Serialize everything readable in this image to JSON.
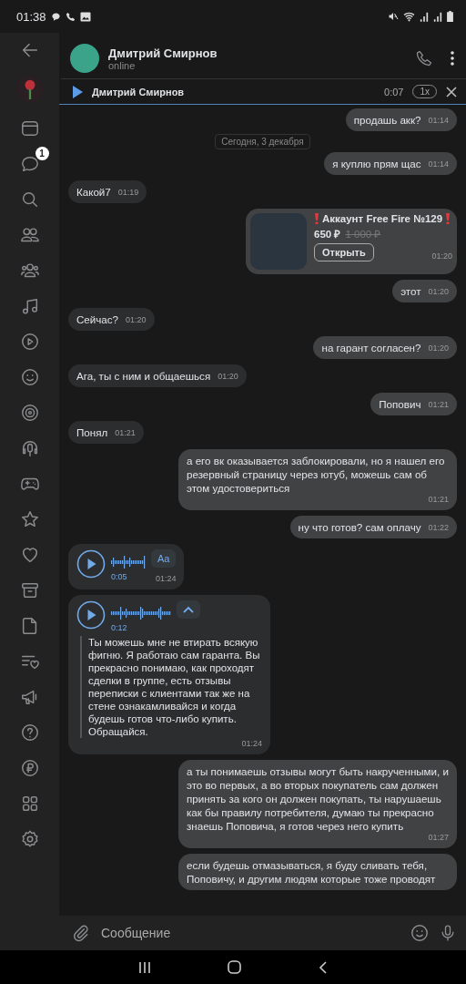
{
  "status_bar": {
    "time": "01:38"
  },
  "sidebar": {
    "items": [
      {
        "kind": "back"
      },
      {
        "kind": "community"
      },
      {
        "kind": "window"
      },
      {
        "kind": "chat",
        "badge": "1"
      },
      {
        "kind": "search"
      },
      {
        "kind": "people"
      },
      {
        "kind": "group"
      },
      {
        "kind": "music"
      },
      {
        "kind": "video"
      },
      {
        "kind": "smiley"
      },
      {
        "kind": "target"
      },
      {
        "kind": "podcast"
      },
      {
        "kind": "gamepad"
      },
      {
        "kind": "star"
      },
      {
        "kind": "heart"
      },
      {
        "kind": "archive"
      },
      {
        "kind": "document"
      },
      {
        "kind": "wishlist"
      },
      {
        "kind": "megaphone"
      },
      {
        "kind": "help"
      },
      {
        "kind": "ruble"
      },
      {
        "kind": "apps"
      },
      {
        "kind": "settings"
      }
    ]
  },
  "header": {
    "name": "Дмитрий Смирнов",
    "status": "online"
  },
  "player": {
    "title": "Дмитрий Смирнов",
    "time": "0:07",
    "speed": "1x"
  },
  "messages": [
    {
      "kind": "text",
      "outgoing": true,
      "text": "продашь акк?",
      "time": "01:14"
    },
    {
      "kind": "date",
      "text": "Сегодня, 3 декабря"
    },
    {
      "kind": "text",
      "outgoing": true,
      "text": "я куплю прям щас",
      "time": "01:14"
    },
    {
      "kind": "text",
      "outgoing": false,
      "text": "Какой7",
      "time": "01:19"
    },
    {
      "kind": "product",
      "outgoing": true,
      "title": "Аккаунт Free Fire №129",
      "price": "650 ₽",
      "old_price": "1 000 ₽",
      "button": "Открыть",
      "time": "01:20"
    },
    {
      "kind": "text",
      "outgoing": true,
      "text": "этот",
      "time": "01:20"
    },
    {
      "kind": "text",
      "outgoing": false,
      "text": "Сейчас?",
      "time": "01:20"
    },
    {
      "kind": "text",
      "outgoing": true,
      "text": "на гарант согласен?",
      "time": "01:20"
    },
    {
      "kind": "text",
      "outgoing": false,
      "text": "Ага, ты с ним и общаешься",
      "time": "01:20"
    },
    {
      "kind": "text",
      "outgoing": true,
      "text": "Попович",
      "time": "01:21"
    },
    {
      "kind": "text",
      "outgoing": false,
      "text": "Понял",
      "time": "01:21"
    },
    {
      "kind": "text",
      "outgoing": true,
      "text": "а его вк оказывается заблокировали, но я нашел его резервный страницу через ютуб, можешь сам об этом удостовериться",
      "time": "01:21"
    },
    {
      "kind": "text",
      "outgoing": true,
      "text": "ну что готов? сам оплачу",
      "time": "01:22"
    },
    {
      "kind": "voice",
      "outgoing": false,
      "duration": "0:05",
      "time": "01:24",
      "expanded": false,
      "button": "Aa"
    },
    {
      "kind": "voice",
      "outgoing": false,
      "duration": "0:12",
      "time": "01:24",
      "expanded": true,
      "transcript": "Ты можешь мне не втирать всякую фигню. Я работаю сам гаранта. Вы прекрасно понимаю, как проходят сделки в группе, есть отзывы переписки с клиентами так же на стене ознакамливайся и когда будешь готов что-либо купить. Обращайся."
    },
    {
      "kind": "text",
      "outgoing": true,
      "text": "а ты понимаешь отзывы могут быть накрученными, и это во первых, а во вторых покупатель сам должен принять за кого он должен покупать, ты нарушаешь как бы правилу потребителя, думаю ты прекрасно знаешь Поповича, я готов через него купить",
      "time": "01:27"
    },
    {
      "kind": "text",
      "outgoing": true,
      "text": "если будешь отмазываться, я буду сливать тебя, Поповичу, и другим людям которые тоже проводят"
    }
  ],
  "composer": {
    "placeholder": "Сообщение"
  }
}
